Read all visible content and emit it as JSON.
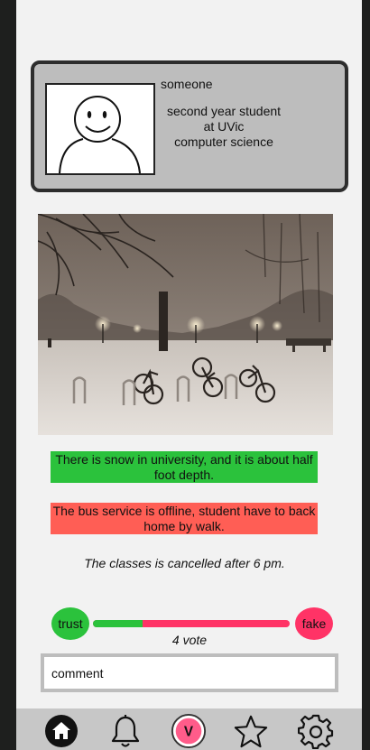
{
  "profile": {
    "name": "someone",
    "bio_lines": [
      "second year student",
      "at UVic",
      "computer science"
    ]
  },
  "post": {
    "photo": "snowy-campus-night-photo",
    "claims": {
      "true_claim": "There is snow in university, and it is about half foot depth.",
      "false_claim": "The bus service is offline, student have to back home by walk.",
      "neutral_claim": "The classes is cancelled after 6 pm."
    }
  },
  "voting": {
    "trust_label": "trust",
    "fake_label": "fake",
    "trust_fraction": 0.25,
    "vote_count_text": "4 vote"
  },
  "comment": {
    "placeholder": "comment"
  },
  "nav": {
    "items": [
      "home-icon",
      "bell-icon",
      "v-icon",
      "star-icon",
      "gear-icon"
    ],
    "v_label": "V"
  },
  "colors": {
    "trust": "#2bc23c",
    "false_claim": "#ff5e55",
    "fake": "#ff3366",
    "card": "#bdbdbd"
  }
}
